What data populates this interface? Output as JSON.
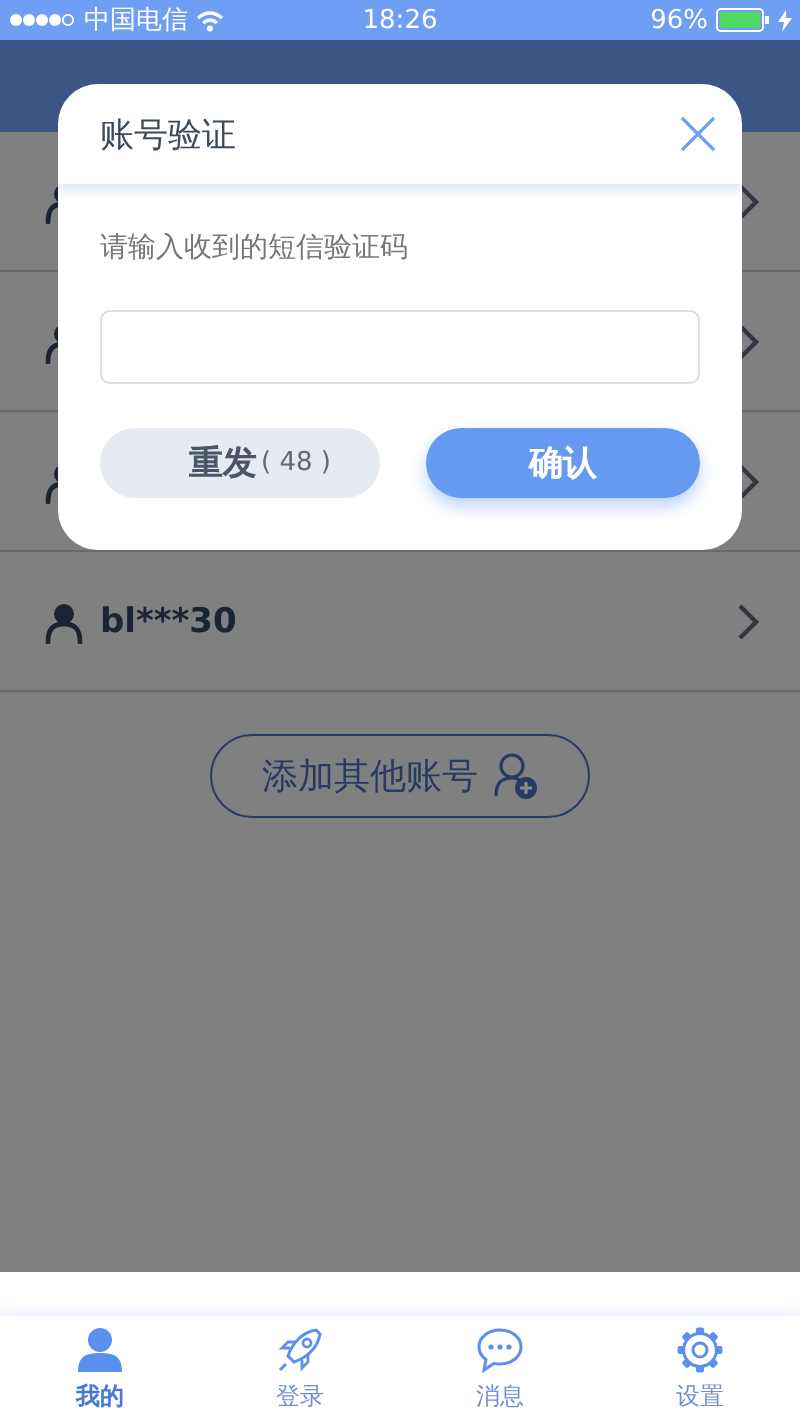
{
  "status_bar": {
    "carrier": "中国电信",
    "time": "18:26",
    "battery": "96%"
  },
  "accounts": [
    {
      "kind": "covered"
    },
    {
      "kind": "covered"
    },
    {
      "kind": "covered"
    },
    {
      "kind": "account",
      "name": "bl***30"
    }
  ],
  "add_account": {
    "label": "添加其他账号"
  },
  "dialog": {
    "title": "账号验证",
    "prompt": "请输入收到的短信验证码",
    "resend": {
      "label": "重发",
      "countdown": "( 48 )",
      "disabled": true
    },
    "confirm": {
      "label": "确认"
    }
  },
  "tab_bar": [
    {
      "kind": "me",
      "label": "我的",
      "selected": true
    },
    {
      "kind": "login",
      "label": "登录",
      "selected": false
    },
    {
      "kind": "messages",
      "label": "消息",
      "selected": false
    },
    {
      "kind": "settings",
      "label": "设置",
      "selected": false
    }
  ]
}
